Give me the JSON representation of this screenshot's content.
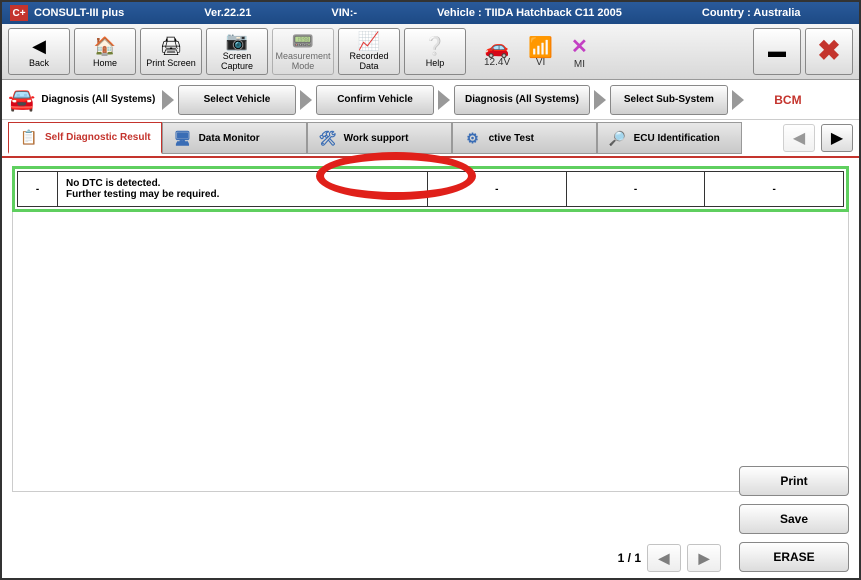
{
  "title_bar": {
    "app": "CONSULT-III plus",
    "version": "Ver.22.21",
    "vin_label": "VIN:-",
    "vehicle_label": "Vehicle : TIIDA Hatchback C11 2005",
    "country_label": "Country : Australia"
  },
  "toolbar": {
    "back": "Back",
    "home": "Home",
    "print_screen": "Print Screen",
    "screen_capture": "Screen Capture",
    "measurement_mode": "Measurement Mode",
    "recorded_data": "Recorded Data",
    "help": "Help"
  },
  "status": {
    "voltage": "12.4V",
    "vi": "VI",
    "mi": "MI"
  },
  "breadcrumbs": {
    "start": "Diagnosis (All Systems)",
    "b1": "Select Vehicle",
    "b2": "Confirm Vehicle",
    "b3": "Diagnosis (All Systems)",
    "b4": "Select Sub-System",
    "final": "BCM"
  },
  "tabs": {
    "t1": "Self Diagnostic Result",
    "t2": "Data Monitor",
    "t3": "Work support",
    "t4_partial": "ctive Test",
    "t5": "ECU Identification"
  },
  "result_row": {
    "c0": "-",
    "c1_line1": "No DTC is detected.",
    "c1_line2": "Further testing may be required.",
    "c2": "-",
    "c3": "-",
    "c4": "-"
  },
  "pager": {
    "label": "1 / 1"
  },
  "side_buttons": {
    "print": "Print",
    "save": "Save",
    "erase": "ERASE"
  }
}
